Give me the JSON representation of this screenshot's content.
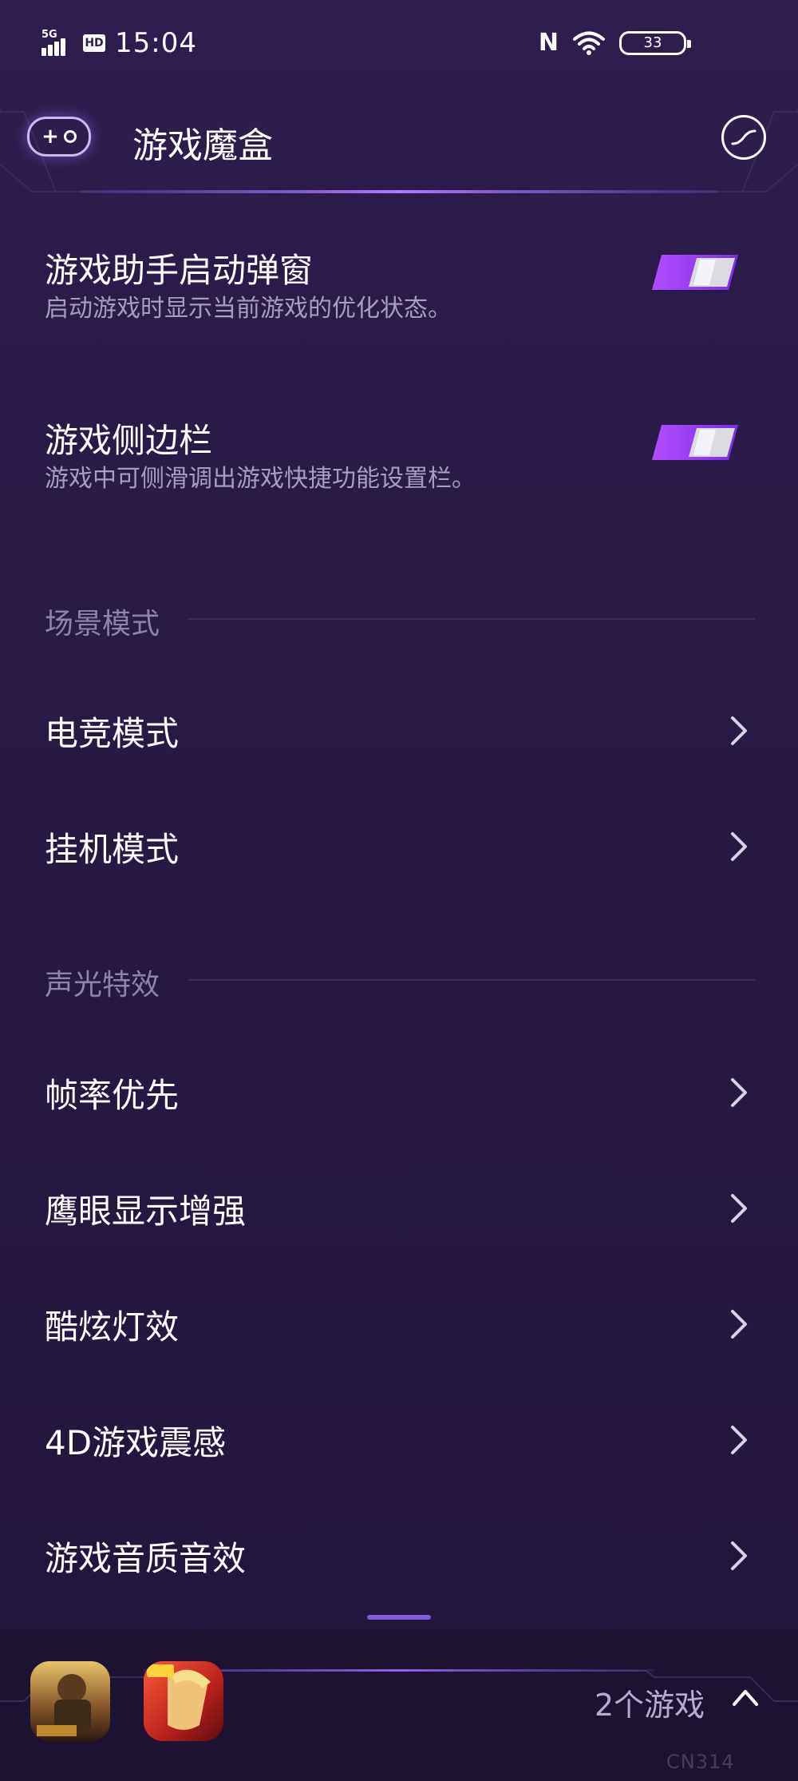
{
  "status_bar": {
    "network": "5G",
    "hd": "HD",
    "time": "15:04",
    "nfc": "N",
    "battery": "33"
  },
  "header": {
    "title": "游戏魔盒",
    "left_icon": "gamepad-add-icon",
    "right_icon": "performance-curve-icon"
  },
  "toggles": [
    {
      "title": "游戏助手启动弹窗",
      "description": "启动游戏时显示当前游戏的优化状态。",
      "on": true
    },
    {
      "title": "游戏侧边栏",
      "description": "游戏中可侧滑调出游戏快捷功能设置栏。",
      "on": true
    }
  ],
  "sections": {
    "scene": {
      "label": "场景模式",
      "items": [
        "电竞模式",
        "挂机模式"
      ]
    },
    "av": {
      "label": "声光特效",
      "items": [
        "帧率优先",
        "鹰眼显示增强",
        "酷炫灯效",
        "4D游戏震感",
        "游戏音质音效"
      ]
    }
  },
  "dock": {
    "games": [
      "game-pubg-icon",
      "game-honor-of-kings-icon"
    ],
    "count_label": "2个游戏",
    "expand_icon": "chevron-up-icon"
  },
  "watermark": "CN314",
  "colors": {
    "background": "#281a43",
    "accent": "#9b5cff",
    "toggle_on": "#8a3ff0",
    "secondary_text": "#a89cc0"
  }
}
